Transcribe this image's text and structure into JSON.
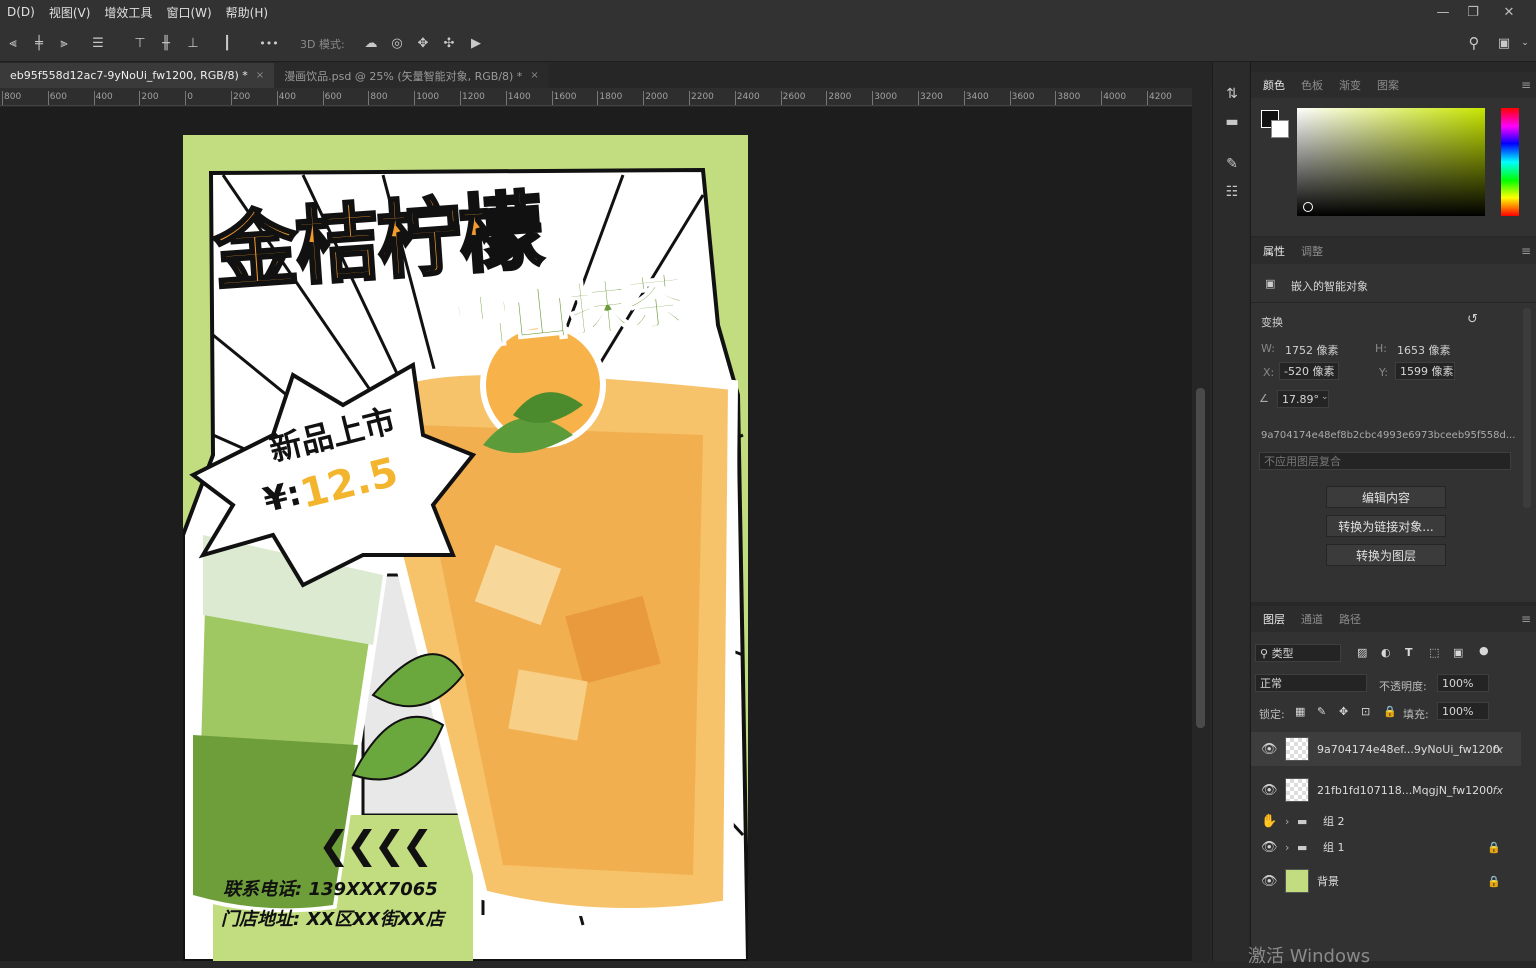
{
  "menu": [
    "D(D)",
    "视图(V)",
    "增效工具",
    "窗口(W)",
    "帮助(H)"
  ],
  "window_controls": [
    "—",
    "❐",
    "✕"
  ],
  "options": {
    "mode_label": "3D 模式:",
    "more_label": "•••"
  },
  "tabs": [
    {
      "label": "eb95f558d12ac7-9yNoUi_fw1200, RGB/8) *",
      "close": "×"
    },
    {
      "label": "漫画饮品.psd @ 25% (矢量智能对象, RGB/8) *",
      "close": "×"
    }
  ],
  "ruler_labels": [
    "800",
    "600",
    "400",
    "200",
    "0",
    "200",
    "400",
    "600",
    "800",
    "1000",
    "1200",
    "1400",
    "1600",
    "1800",
    "2000",
    "2200",
    "2400",
    "2600",
    "2800",
    "3000",
    "3200",
    "3400",
    "3600",
    "3800",
    "4000",
    "4200",
    "4"
  ],
  "poster": {
    "title": "金桔柠檬",
    "subtitle": "雪山抹茶",
    "badge": "新品上市",
    "price_prefix": "¥:",
    "price": "12.5",
    "arrows": "❮❮❮❮",
    "phone": "联系电话: 139XXX7065",
    "address": "门店地址: XX区XX街XX店",
    "colors": {
      "bg": "#c2dc80",
      "orange": "#f39a2e",
      "green": "#6e9b3a",
      "black": "#111111"
    }
  },
  "color_panel": {
    "tabs": [
      "颜色",
      "色板",
      "渐变",
      "图案"
    ],
    "active": 0,
    "hue_color": "#c8e600"
  },
  "properties": {
    "tabs": [
      "属性",
      "调整"
    ],
    "active": 0,
    "object_type": "嵌入的智能对象",
    "transform_label": "变换",
    "w_label": "W:",
    "w_value": "1752 像素",
    "h_label": "H:",
    "h_value": "1653 像素",
    "x_label": "X:",
    "x_value": "-520 像素",
    "y_label": "Y:",
    "y_value": "1599 像素",
    "angle_value": "17.89°",
    "filename": "9a704174e48ef8b2cbc4993e6973bceeb95f558d...",
    "comp_placeholder": "不应用图层复合",
    "buttons": [
      "编辑内容",
      "转换为链接对象...",
      "转换为图层"
    ]
  },
  "layers": {
    "tabs": [
      "图层",
      "通道",
      "路径"
    ],
    "active": 0,
    "filter_label": "类型",
    "blend_mode": "正常",
    "opacity_label": "不透明度:",
    "opacity_value": "100%",
    "lock_label": "锁定:",
    "fill_label": "填充:",
    "fill_value": "100%",
    "items": [
      {
        "name": "9a704174e48ef...9yNoUi_fw1200",
        "kind": "smart",
        "fx": "fx"
      },
      {
        "name": "21fb1fd107118...MqgjN_fw1200",
        "kind": "smart",
        "fx": "fx"
      },
      {
        "name": "组 2",
        "kind": "group"
      },
      {
        "name": "组 1",
        "kind": "group"
      },
      {
        "name": "背景",
        "kind": "background"
      }
    ]
  },
  "watermark": "激活 Windows"
}
